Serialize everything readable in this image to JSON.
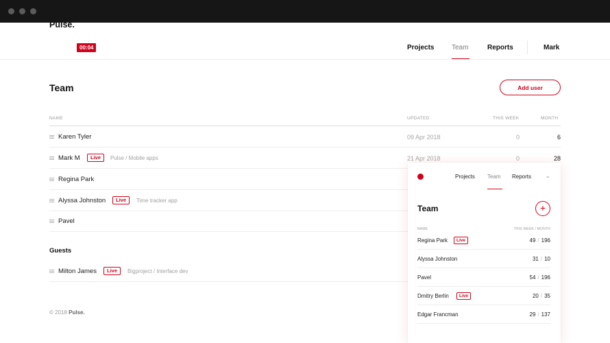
{
  "header": {
    "brand": "Pulse.",
    "timer": "00:04",
    "nav": {
      "projects": "Projects",
      "team": "Team",
      "reports": "Reports"
    },
    "user": "Mark"
  },
  "page": {
    "title": "Team",
    "add_label": "Add user"
  },
  "table": {
    "columns": {
      "name": "NAME",
      "updated": "UPDATED",
      "this_week": "THIS WEEK",
      "month": "MONTH"
    },
    "rows": [
      {
        "name": "Karen Tyler",
        "badge": "",
        "project": "",
        "updated": "09 Apr 2018",
        "week": "0",
        "month": "6"
      },
      {
        "name": "Mark M",
        "badge": "Live",
        "project": "Pulse / Mobile apps",
        "updated": "21 Apr 2018",
        "week": "0",
        "month": "28"
      },
      {
        "name": "Regina Park",
        "badge": "",
        "project": "",
        "updated": "",
        "week": "",
        "month": ""
      },
      {
        "name": "Alyssa Johnston",
        "badge": "Live",
        "project": "Time tracker app",
        "updated": "",
        "week": "",
        "month": ""
      },
      {
        "name": "Pavel",
        "badge": "",
        "project": "",
        "updated": "",
        "week": "",
        "month": ""
      }
    ]
  },
  "guests": {
    "title": "Guests",
    "rows": [
      {
        "name": "Milton James",
        "badge": "Live",
        "project": "Bigproject / Interface dev"
      }
    ]
  },
  "footer": {
    "copyright": "© 2018",
    "brand": "Pulse."
  },
  "mobile": {
    "nav": {
      "projects": "Projects",
      "team": "Team",
      "reports": "Reports"
    },
    "chevron": "⌄",
    "title": "Team",
    "add_symbol": "+",
    "columns": {
      "name": "NAME",
      "stats": "THIS WEEK / MONTH"
    },
    "rows": [
      {
        "name": "Regina Park",
        "badge": "Live",
        "week": "49",
        "month": "196"
      },
      {
        "name": "Alyssa Johnston",
        "badge": "",
        "week": "31",
        "month": "10"
      },
      {
        "name": "Pavel",
        "badge": "",
        "week": "54",
        "month": "196"
      },
      {
        "name": "Dmitry Berlin",
        "badge": "Live",
        "week": "20",
        "month": "35"
      },
      {
        "name": "Edgar Francman",
        "badge": "",
        "week": "29",
        "month": "137"
      }
    ]
  },
  "colors": {
    "accent": "#d0021b",
    "chrome": "#161616",
    "muted": "#9a9a9a"
  }
}
